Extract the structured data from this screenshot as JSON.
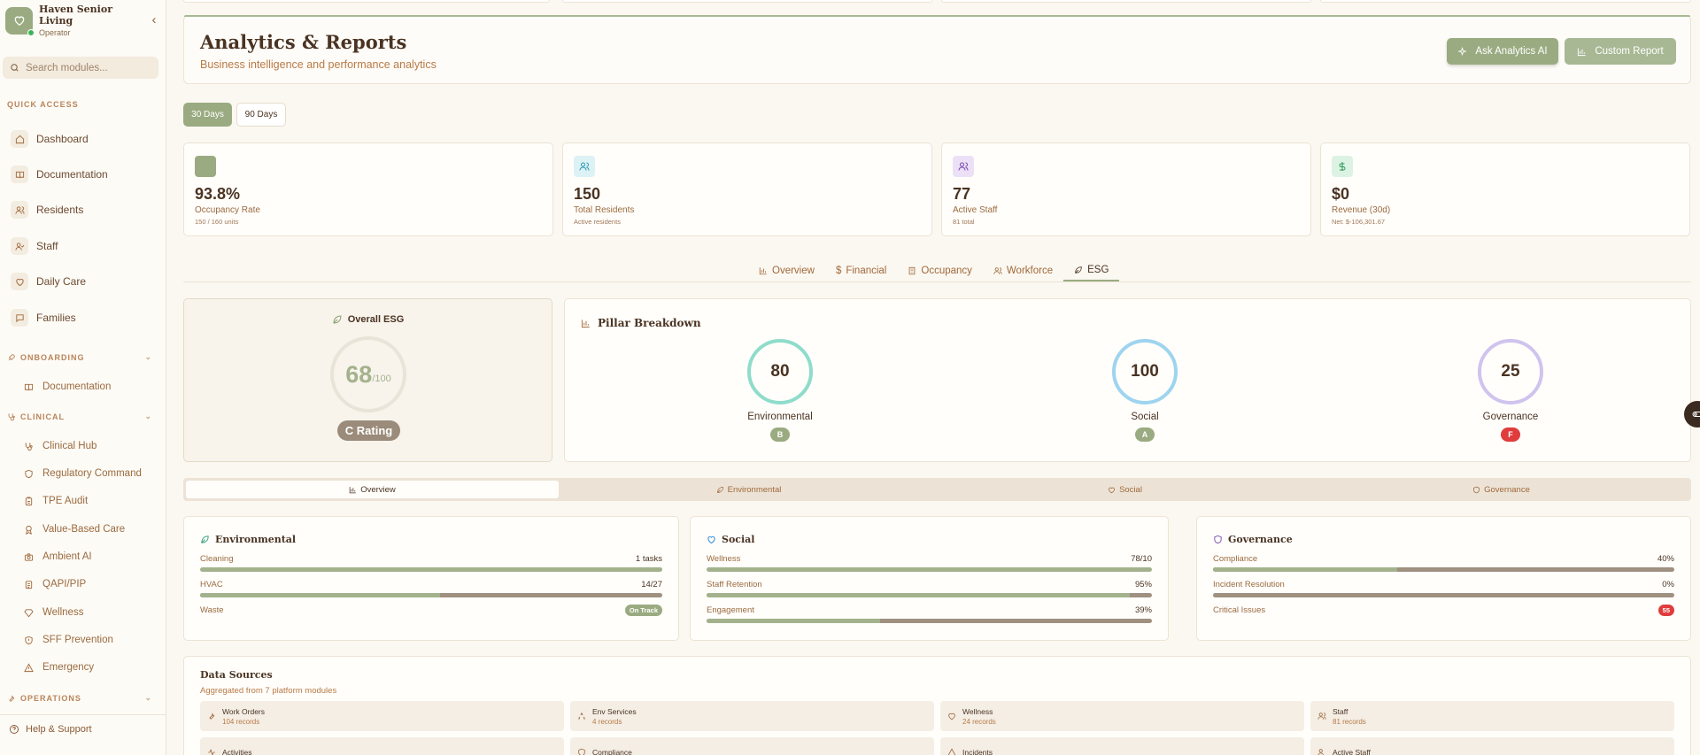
{
  "sidebar": {
    "org_name": "Haven Senior Living",
    "org_role": "Operator",
    "search_placeholder": "Search modules...",
    "quick_access_label": "QUICK ACCESS",
    "quick_items": [
      {
        "label": "Dashboard",
        "icon": "home-icon"
      },
      {
        "label": "Documentation",
        "icon": "book-icon"
      },
      {
        "label": "Residents",
        "icon": "users-icon"
      },
      {
        "label": "Staff",
        "icon": "user-check-icon"
      },
      {
        "label": "Daily Care",
        "icon": "heart-icon"
      },
      {
        "label": "Families",
        "icon": "message-icon"
      }
    ],
    "onboarding_label": "ONBOARDING",
    "onboarding_items": [
      {
        "label": "Documentation",
        "icon": "book-icon"
      }
    ],
    "clinical_label": "CLINICAL",
    "clinical_items": [
      {
        "label": "Clinical Hub",
        "icon": "stethoscope-icon"
      },
      {
        "label": "Regulatory Command",
        "icon": "shield-icon"
      },
      {
        "label": "TPE Audit",
        "icon": "clipboard-icon"
      },
      {
        "label": "Value-Based Care",
        "icon": "award-icon"
      },
      {
        "label": "Ambient AI",
        "icon": "camera-icon"
      },
      {
        "label": "QAPI/PIP",
        "icon": "clipboard-list-icon"
      },
      {
        "label": "Wellness",
        "icon": "gem-icon"
      },
      {
        "label": "SFF Prevention",
        "icon": "shield-alert-icon"
      },
      {
        "label": "Emergency",
        "icon": "alert-triangle-icon"
      }
    ],
    "operations_label": "OPERATIONS",
    "help_label": "Help & Support"
  },
  "header": {
    "title": "Analytics & Reports",
    "subtitle": "Business intelligence and performance analytics",
    "ai_button": "Ask Analytics AI",
    "report_button": "Custom Report"
  },
  "ranges": {
    "active": "30 Days",
    "other": "90 Days"
  },
  "kpis": [
    {
      "value": "93.8%",
      "label": "Occupancy Rate",
      "sub": "150 / 160 units",
      "icon": "square-icon",
      "color": "#9aab81"
    },
    {
      "value": "150",
      "label": "Total Residents",
      "sub": "Active residents",
      "icon": "users-icon",
      "color": "#2e9ab0"
    },
    {
      "value": "77",
      "label": "Active Staff",
      "sub": "81 total",
      "icon": "users-icon",
      "color": "#7a48b0"
    },
    {
      "value": "$0",
      "label": "Revenue (30d)",
      "sub": "Net: $-106,301.67",
      "icon": "dollar-icon",
      "color": "#2e9a5a"
    }
  ],
  "tabs": [
    "Overview",
    "Financial",
    "Occupancy",
    "Workforce",
    "ESG"
  ],
  "active_tab": "ESG",
  "esg": {
    "overall_title": "Overall ESG",
    "score": "68",
    "score_max": "/100",
    "rating": "C Rating",
    "pillar_title": "Pillar Breakdown",
    "pillars": [
      {
        "name": "Environmental",
        "score": "80",
        "grade": "B",
        "ring_color": "#8fdccb",
        "grade_color": "#9aab81"
      },
      {
        "name": "Social",
        "score": "100",
        "grade": "A",
        "ring_color": "#9ed4ef",
        "grade_color": "#9aab81"
      },
      {
        "name": "Governance",
        "score": "25",
        "grade": "F",
        "ring_color": "#cfc4ee",
        "grade_color": "#e03c3c"
      }
    ]
  },
  "subtabs": [
    "Overview",
    "Environmental",
    "Social",
    "Governance"
  ],
  "metrics": [
    {
      "title": "Environmental",
      "icon": "leaf-icon",
      "rows": [
        {
          "label": "Cleaning",
          "value": "1 tasks",
          "progress": 1.0
        },
        {
          "label": "HVAC",
          "value": "14/27",
          "progress": 0.52
        },
        {
          "label": "Waste",
          "badge": "On Track",
          "badge_color": "#9aab81"
        }
      ]
    },
    {
      "title": "Social",
      "icon": "heart-icon",
      "rows": [
        {
          "label": "Wellness",
          "value": "78/10",
          "progress": 1.0
        },
        {
          "label": "Staff Retention",
          "value": "95%",
          "progress": 0.95
        },
        {
          "label": "Engagement",
          "value": "39%",
          "progress": 0.39
        }
      ]
    },
    {
      "title": "Governance",
      "icon": "shield-icon",
      "rows": [
        {
          "label": "Compliance",
          "value": "40%",
          "progress": 0.4
        },
        {
          "label": "Incident Resolution",
          "value": "0%",
          "progress": 0.0
        },
        {
          "label": "Critical Issues",
          "badge": "55",
          "badge_color": "#e03c3c"
        }
      ]
    }
  ],
  "data_sources": {
    "title": "Data Sources",
    "subtitle": "Aggregated from 7 platform modules",
    "items": [
      {
        "name": "Work Orders",
        "count": "104 records",
        "icon": "wrench-icon"
      },
      {
        "name": "Env Services",
        "count": "4 records",
        "icon": "recycle-icon"
      },
      {
        "name": "Wellness",
        "count": "24 records",
        "icon": "heart-icon"
      },
      {
        "name": "Staff",
        "count": "81 records",
        "icon": "users-icon"
      },
      {
        "name": "Activities",
        "count": "",
        "icon": "activity-icon"
      },
      {
        "name": "Compliance",
        "count": "",
        "icon": "shield-icon"
      },
      {
        "name": "Incidents",
        "count": "",
        "icon": "alert-triangle-icon"
      },
      {
        "name": "Active Staff",
        "count": "",
        "icon": "users-icon"
      }
    ]
  }
}
